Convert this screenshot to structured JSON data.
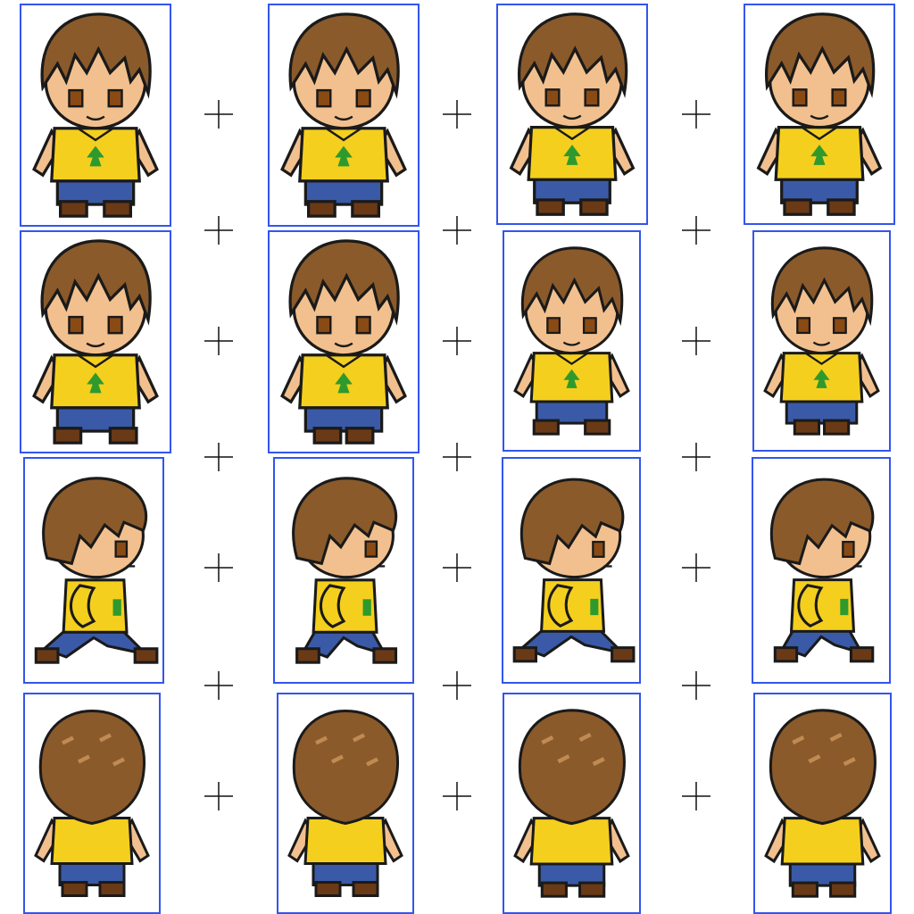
{
  "sprite_sheet": {
    "rows": [
      {
        "direction": "front",
        "frames": 4
      },
      {
        "direction": "front-walk",
        "frames": 4
      },
      {
        "direction": "side",
        "frames": 4
      },
      {
        "direction": "back",
        "frames": 4
      }
    ],
    "colors": {
      "frame_border": "#3355ee",
      "hair": "#8a5a2b",
      "hair_shadow": "#5a3416",
      "skin": "#f2c08e",
      "eyes": "#8a4a14",
      "shirt": "#f5cf1e",
      "shirt_emblem": "#2e9a2e",
      "pants": "#3a5aa8",
      "shoes": "#6a3a16",
      "outline": "#1a1a1a",
      "magenta_artifact": "#c020e0"
    }
  }
}
